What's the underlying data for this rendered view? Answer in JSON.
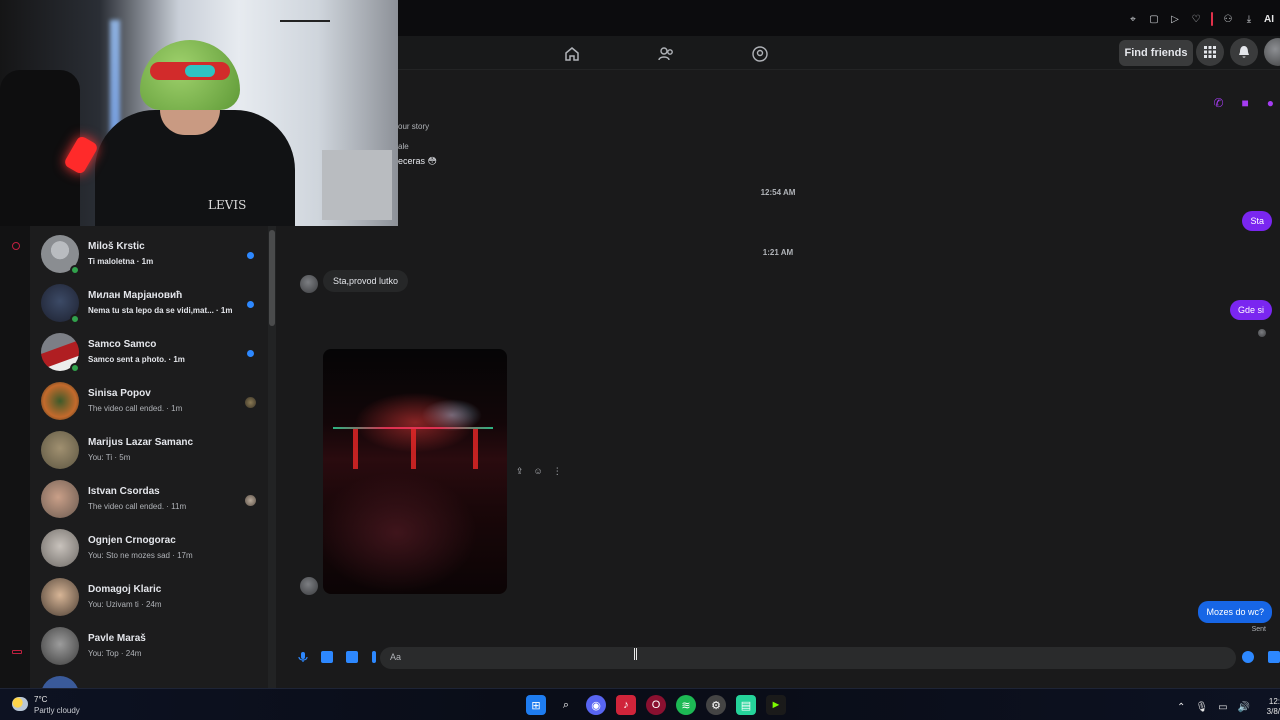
{
  "browser": {
    "ai_label": "AI"
  },
  "nav": {
    "find_friends": "Find friends"
  },
  "story": {
    "line1": "our story",
    "line2": "ale",
    "line3": "eceras 😳"
  },
  "chat": {
    "time1": "12:54 AM",
    "msg_sta": "Sta",
    "time2": "1:21 AM",
    "msg_in1": "Sta,provod lutko",
    "msg_gde": "Gde si",
    "msg_mozes": "Mozes do wc?",
    "sent": "Sent"
  },
  "composer": {
    "placeholder": "Aa"
  },
  "conversations": [
    {
      "name": "Miloš Krstic",
      "preview": "Ti maloletna · 1m",
      "unread": true,
      "online": true
    },
    {
      "name": "Милан Марјановић",
      "preview": "Nema tu sta lepo da se vidi,mat... · 1m",
      "unread": true,
      "online": true
    },
    {
      "name": "Samco Samco",
      "preview": "Samco sent a photo. · 1m",
      "unread": true,
      "online": true
    },
    {
      "name": "Sinisa Popov",
      "preview": "The video call ended. · 1m",
      "unread": false,
      "online": false
    },
    {
      "name": "Marijus Lazar Samanc",
      "preview": "You: Ti · 5m",
      "unread": false,
      "online": false
    },
    {
      "name": "Istvan Csordas",
      "preview": "The video call ended. · 11m",
      "unread": false,
      "online": false
    },
    {
      "name": "Ognjen Crnogorac",
      "preview": "You: Sto ne mozes sad · 17m",
      "unread": false,
      "online": false
    },
    {
      "name": "Domagoj Klaric",
      "preview": "You: Uzivam ti · 24m",
      "unread": false,
      "online": false
    },
    {
      "name": "Pavle Maraš",
      "preview": "You: Top · 24m",
      "unread": false,
      "online": false
    }
  ],
  "webcam": {
    "logo": "LEVIS"
  },
  "taskbar": {
    "temp": "7°C",
    "condition": "Partly cloudy",
    "time": "12:",
    "date": "3/8/"
  },
  "colors": {
    "messenger_purple": "#7a26f0",
    "messenger_blue": "#1766e6",
    "unread_blue": "#2d88ff",
    "online_green": "#31a24c"
  }
}
